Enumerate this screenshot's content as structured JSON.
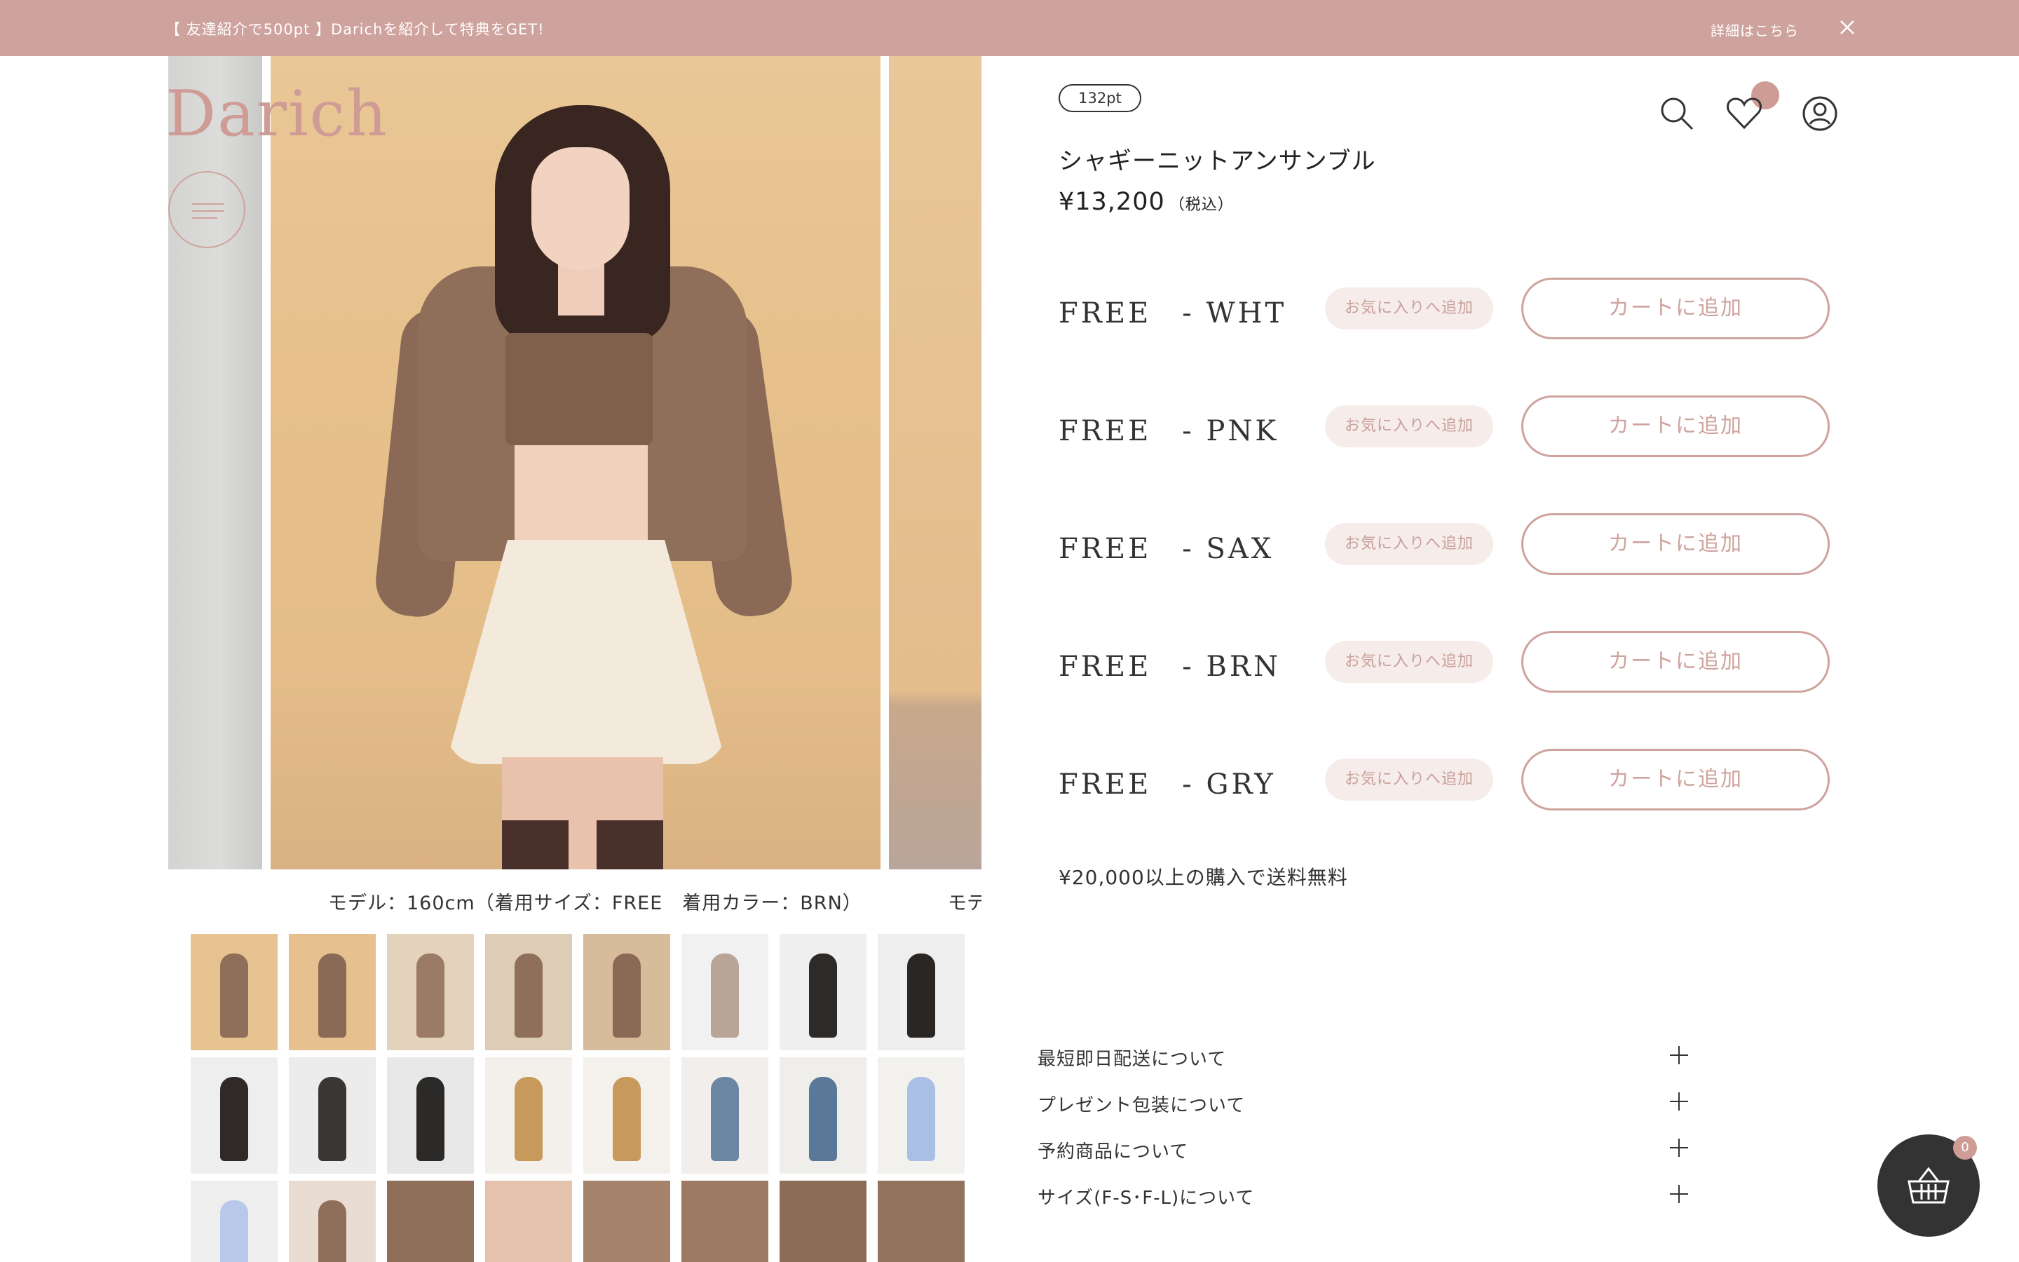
{
  "announcement": {
    "message": "【 友達紹介で500pt 】Darichを紹介して特典をGET!",
    "details_link": "詳細はこちら"
  },
  "brand": {
    "logo": "Darich"
  },
  "gallery": {
    "caption_main": "モデル：160cm（着用サイズ：FREE　着用カラー：BRN）",
    "caption_next": "モテ"
  },
  "product": {
    "points_badge": "132pt",
    "name": "シャギーニットアンサンブル",
    "price": "¥13,200",
    "tax_note": "（税込）",
    "variants": [
      {
        "label": "FREE　- WHT",
        "favorite": "お気に入りへ追加",
        "cart": "カートに追加"
      },
      {
        "label": "FREE　- PNK",
        "favorite": "お気に入りへ追加",
        "cart": "カートに追加"
      },
      {
        "label": "FREE　- SAX",
        "favorite": "お気に入りへ追加",
        "cart": "カートに追加"
      },
      {
        "label": "FREE　- BRN",
        "favorite": "お気に入りへ追加",
        "cart": "カートに追加"
      },
      {
        "label": "FREE　- GRY",
        "favorite": "お気に入りへ追加",
        "cart": "カートに追加"
      }
    ],
    "shipping_note": "¥20,000以上の購入で送料無料"
  },
  "accordion": [
    {
      "label": "最短即日配送について"
    },
    {
      "label": "プレゼント包装について"
    },
    {
      "label": "予約商品について"
    },
    {
      "label": "サイズ(F-S･F-L)について"
    }
  ],
  "cart": {
    "count": "0"
  },
  "icons": {
    "close": "close-icon",
    "menu": "hamburger-menu-icon",
    "search": "search-icon",
    "favorites": "heart-icon",
    "account": "user-icon",
    "cart": "basket-icon",
    "accordion": "plus-icon"
  },
  "colors": {
    "accent": "#cfa39d",
    "accent_dark": "#cf9c95",
    "text": "#333333",
    "fab": "#333333"
  }
}
